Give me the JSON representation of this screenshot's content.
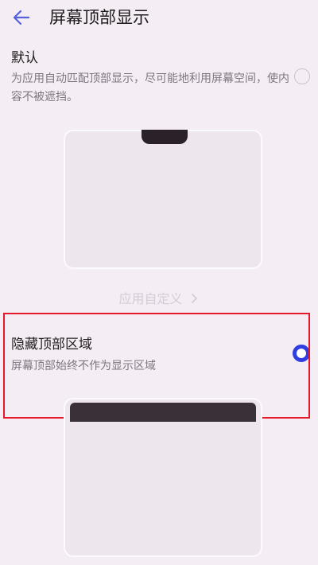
{
  "header": {
    "title": "屏幕顶部显示",
    "back_icon": "arrow-left-icon",
    "accent_color": "#5561dd"
  },
  "options": [
    {
      "title": "默认",
      "description": "为应用自动匹配顶部显示，尽可能地利用屏幕空间，使内容不被遮挡。",
      "selected": false
    },
    {
      "title": "隐藏顶部区域",
      "description": "屏幕顶部始终不作为显示区域",
      "selected": true
    }
  ],
  "custom_link": {
    "label": "应用自定义",
    "icon": "chevron-right-icon"
  },
  "colors": {
    "radio_selected": "#2f3de1",
    "highlight_border": "#e5182c",
    "background": "#f4edf3"
  }
}
